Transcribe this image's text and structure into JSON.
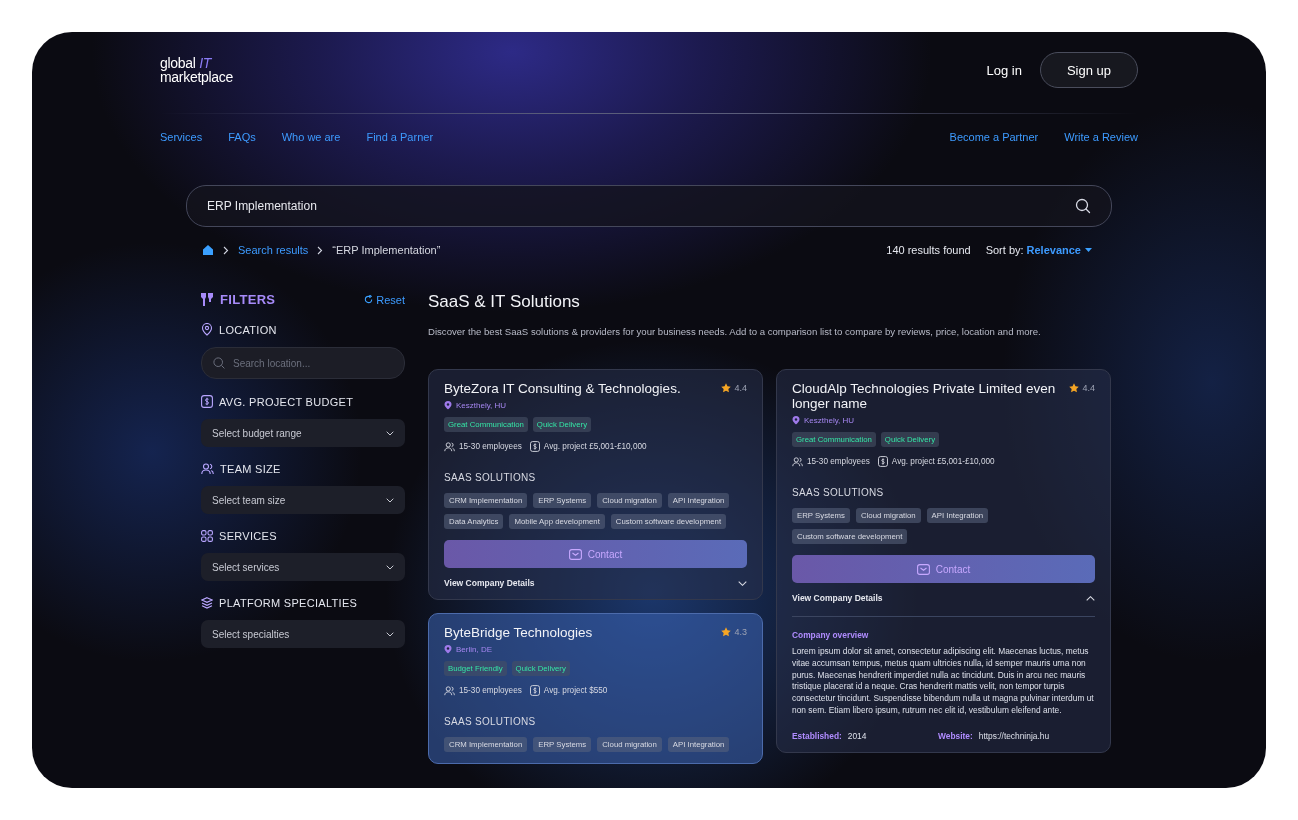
{
  "logo": {
    "line_1": "global",
    "accent": "IT",
    "line_2": "marketplace"
  },
  "auth": {
    "login": "Log in",
    "signup": "Sign up"
  },
  "nav": {
    "left": [
      "Services",
      "FAQs",
      "Who we are",
      "Find a Parner"
    ],
    "right": [
      "Become a Partner",
      "Write a Review"
    ]
  },
  "search": {
    "value": "ERP Implementation"
  },
  "breadcrumb": [
    "Search results",
    "“ERP Implementation”"
  ],
  "results": {
    "count": "140 results found",
    "sort_label": "Sort by:",
    "sort_value": "Relevance"
  },
  "filters": {
    "title": "FILTERS",
    "reset": "Reset",
    "groups": [
      {
        "kind": "search",
        "label": "LOCATION",
        "placeholder": "Search location..."
      },
      {
        "kind": "select",
        "label": "AVG. PROJECT BUDGET",
        "placeholder": "Select budget range"
      },
      {
        "kind": "select",
        "label": "TEAM SIZE",
        "placeholder": "Select team size"
      },
      {
        "kind": "select",
        "label": "SERVICES",
        "placeholder": "Select services"
      },
      {
        "kind": "select",
        "label": "PLATFORM SPECIALTIES",
        "placeholder": "Select specialties"
      }
    ]
  },
  "section": {
    "title": "SaaS & IT Solutions",
    "description": "Discover the best SaaS solutions & providers for your business needs. Add to a comparison list to compare by reviews, price, location and more."
  },
  "columns": [
    [
      {
        "name": "ByteZora IT Consulting & Technologies.",
        "rating": "4.4",
        "location": "Keszthely, HU",
        "highlighted": false,
        "badges": [
          "Great Communication",
          "Quick Delivery"
        ],
        "employees": "15-30 employees",
        "budget": "Avg. project £5,001-£10,000",
        "solutions_title": "SAAS SOLUTIONS",
        "solutions": [
          "CRM Implementation",
          "ERP Systems",
          "Cloud migration",
          "API Integration",
          "Data Analytics",
          "Mobile App development",
          "Custom software development"
        ],
        "contact": "Contact",
        "details_label": "View Company Details",
        "expanded": false
      },
      {
        "name": "ByteBridge Technologies",
        "rating": "4.3",
        "location": "Berlin, DE",
        "highlighted": true,
        "badges": [
          "Budget Friendly",
          "Quick Delivery"
        ],
        "employees": "15-30 employees",
        "budget": "Avg. project $550",
        "solutions_title": "SAAS SOLUTIONS",
        "solutions": [
          "CRM Implementation",
          "ERP Systems",
          "Cloud migration",
          "API Integration"
        ]
      }
    ],
    [
      {
        "name": "CloudAlp Technologies Private Limited even longer name",
        "rating": "4.4",
        "location": "Keszthely, HU",
        "highlighted": false,
        "badges": [
          "Great Communication",
          "Quick Delivery"
        ],
        "employees": "15-30 employees",
        "budget": "Avg. project £5,001-£10,000",
        "solutions_title": "SAAS SOLUTIONS",
        "solutions": [
          "ERP Systems",
          "Cloud migration",
          "API Integration",
          "Custom software development"
        ],
        "contact": "Contact",
        "details_label": "View Company Details",
        "expanded": true,
        "details": {
          "overview_title": "Company overview",
          "overview": "Lorem ipsum dolor sit amet, consectetur adipiscing elit. Maecenas luctus, metus vitae accumsan tempus, metus quam ultricies nulla, id semper mauris urna non purus. Maecenas hendrerit imperdiet nulla ac tincidunt. Duis in arcu nec mauris tristique placerat id a neque. Cras hendrerit mattis velit, non tempor turpis consectetur tincidunt. Suspendisse bibendum nulla ut magna pulvinar interdum ut non sem. Etiam libero ipsum, rutrum nec elit id, vestibulum eleifend ante.",
          "established_label": "Established:",
          "established": "2014",
          "website_label": "Website:",
          "website": "https://techninja.hu"
        }
      }
    ]
  ]
}
